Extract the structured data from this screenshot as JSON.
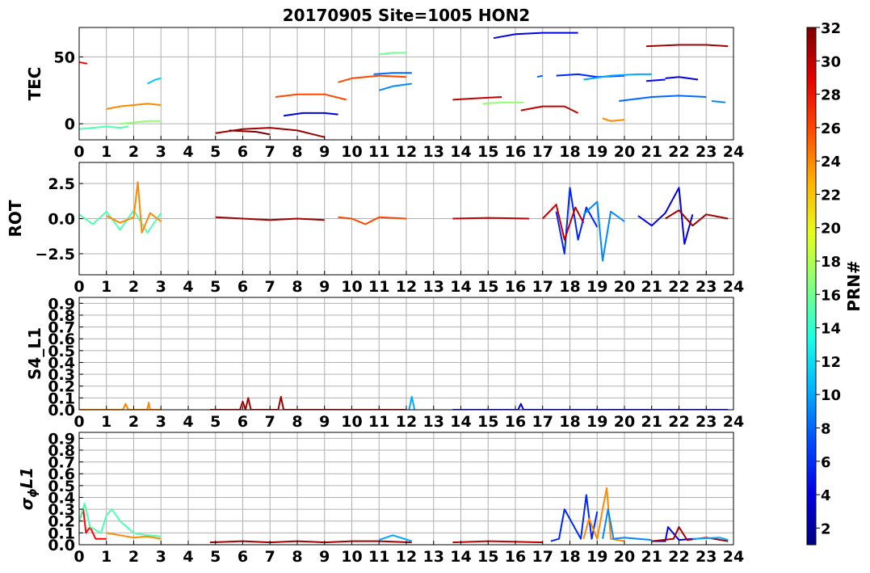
{
  "title": "20170905 Site=1005 HON2",
  "colorbar": {
    "label": "PRN#",
    "min": 1,
    "max": 32,
    "ticks": [
      2,
      4,
      6,
      8,
      10,
      12,
      14,
      16,
      18,
      20,
      22,
      24,
      26,
      28,
      30,
      32
    ],
    "colormap": "jet"
  },
  "chart_data": [
    {
      "type": "line",
      "ylabel": "TEC",
      "xlim": [
        0,
        24
      ],
      "ylim": [
        -12,
        72
      ],
      "xticks": [
        0,
        1,
        2,
        3,
        4,
        5,
        6,
        7,
        8,
        9,
        10,
        11,
        12,
        13,
        14,
        15,
        16,
        17,
        18,
        19,
        20,
        21,
        22,
        23,
        24
      ],
      "yticks": [
        0,
        50
      ],
      "grid": true,
      "series": [
        {
          "prn": 28,
          "x": [
            0.0,
            0.3
          ],
          "y": [
            46,
            45
          ]
        },
        {
          "prn": 15,
          "x": [
            0.0,
            0.5,
            1.0,
            1.5,
            1.8
          ],
          "y": [
            -4,
            -3,
            -2,
            -3,
            -2
          ]
        },
        {
          "prn": 17,
          "x": [
            1.5,
            2.0,
            2.5,
            3.0
          ],
          "y": [
            0,
            1,
            2,
            2
          ]
        },
        {
          "prn": 24,
          "x": [
            1.0,
            1.5,
            2.0,
            2.5,
            3.0
          ],
          "y": [
            11,
            13,
            14,
            15,
            14
          ]
        },
        {
          "prn": 11,
          "x": [
            2.5,
            2.8,
            3.0
          ],
          "y": [
            30,
            33,
            34
          ]
        },
        {
          "prn": 31,
          "x": [
            5.0,
            6.0,
            7.0,
            8.0,
            9.0
          ],
          "y": [
            -7,
            -4,
            -3,
            -5,
            -10
          ]
        },
        {
          "prn": 32,
          "x": [
            5.5,
            6.5,
            7.0
          ],
          "y": [
            -5,
            -6,
            -8
          ]
        },
        {
          "prn": 26,
          "x": [
            7.2,
            8.0,
            9.0,
            9.8
          ],
          "y": [
            20,
            22,
            22,
            18
          ]
        },
        {
          "prn": 4,
          "x": [
            7.5,
            8.2,
            9.0,
            9.5
          ],
          "y": [
            6,
            8,
            8,
            7
          ]
        },
        {
          "prn": 26,
          "x": [
            9.5,
            10.0,
            11.0,
            12.0
          ],
          "y": [
            31,
            34,
            36,
            35
          ]
        },
        {
          "prn": 16,
          "x": [
            11.0,
            11.5,
            12.0
          ],
          "y": [
            52,
            53,
            53
          ]
        },
        {
          "prn": 8,
          "x": [
            10.8,
            11.5,
            12.2
          ],
          "y": [
            37,
            38,
            38
          ]
        },
        {
          "prn": 9,
          "x": [
            11.0,
            11.5,
            12.2
          ],
          "y": [
            25,
            28,
            30
          ]
        },
        {
          "prn": 30,
          "x": [
            13.7,
            14.5,
            15.5
          ],
          "y": [
            18,
            19,
            20
          ]
        },
        {
          "prn": 17,
          "x": [
            14.8,
            15.5,
            16.3
          ],
          "y": [
            15,
            16,
            16
          ]
        },
        {
          "prn": 4,
          "x": [
            15.2,
            16.0,
            17.0,
            18.3
          ],
          "y": [
            64,
            67,
            68,
            68
          ]
        },
        {
          "prn": 30,
          "x": [
            16.2,
            17.0,
            17.8,
            18.3
          ],
          "y": [
            10,
            13,
            13,
            8
          ]
        },
        {
          "prn": 8,
          "x": [
            16.8,
            17.0
          ],
          "y": [
            35,
            36
          ]
        },
        {
          "prn": 6,
          "x": [
            17.5,
            18.3,
            19.0,
            20.0
          ],
          "y": [
            36,
            37,
            35,
            36
          ]
        },
        {
          "prn": 10,
          "x": [
            18.5,
            19.5,
            20.5,
            21.0
          ],
          "y": [
            33,
            36,
            37,
            37
          ]
        },
        {
          "prn": 24,
          "x": [
            19.2,
            19.5,
            20.0
          ],
          "y": [
            4,
            2,
            3
          ]
        },
        {
          "prn": 5,
          "x": [
            20.8,
            21.5
          ],
          "y": [
            32,
            33
          ]
        },
        {
          "prn": 4,
          "x": [
            21.5,
            22.0,
            22.7
          ],
          "y": [
            34,
            35,
            33
          ]
        },
        {
          "prn": 8,
          "x": [
            19.8,
            21.0,
            22.0,
            23.0
          ],
          "y": [
            17,
            20,
            21,
            20
          ]
        },
        {
          "prn": 9,
          "x": [
            23.2,
            23.7
          ],
          "y": [
            17,
            16
          ]
        },
        {
          "prn": 31,
          "x": [
            20.8,
            22.0,
            23.0,
            23.8
          ],
          "y": [
            58,
            59,
            59,
            58
          ]
        }
      ]
    },
    {
      "type": "line",
      "ylabel": "ROT",
      "xlim": [
        0,
        24
      ],
      "ylim": [
        -4,
        4
      ],
      "xticks": [
        0,
        1,
        2,
        3,
        4,
        5,
        6,
        7,
        8,
        9,
        10,
        11,
        12,
        13,
        14,
        15,
        16,
        17,
        18,
        19,
        20,
        21,
        22,
        23,
        24
      ],
      "yticks": [
        -2.5,
        0.0,
        2.5
      ],
      "grid": true,
      "series": [
        {
          "prn": 15,
          "x": [
            0.0,
            0.5,
            1.0,
            1.5,
            2.0,
            2.5,
            3.0
          ],
          "y": [
            0.3,
            -0.4,
            0.5,
            -0.8,
            0.6,
            -1.0,
            0.4
          ]
        },
        {
          "prn": 24,
          "x": [
            1.0,
            1.5,
            2.0,
            2.15,
            2.3,
            2.6,
            3.0
          ],
          "y": [
            0.2,
            -0.3,
            0.1,
            2.6,
            -1.0,
            0.4,
            -0.2
          ]
        },
        {
          "prn": 31,
          "x": [
            5.0,
            6.0,
            7.0,
            8.0,
            9.0
          ],
          "y": [
            0.1,
            0.0,
            -0.1,
            0.0,
            -0.1
          ]
        },
        {
          "prn": 26,
          "x": [
            9.5,
            10.0,
            10.5,
            11.0,
            12.0
          ],
          "y": [
            0.1,
            0.0,
            -0.4,
            0.1,
            0.0
          ]
        },
        {
          "prn": 30,
          "x": [
            13.7,
            15.0,
            16.5
          ],
          "y": [
            0.0,
            0.05,
            0.0
          ]
        },
        {
          "prn": 6,
          "x": [
            17.5,
            17.8,
            18.0,
            18.3,
            18.6,
            19.0
          ],
          "y": [
            0.5,
            -2.5,
            2.2,
            -1.5,
            0.8,
            -0.6
          ]
        },
        {
          "prn": 9,
          "x": [
            18.5,
            19.0,
            19.2,
            19.5,
            20.0
          ],
          "y": [
            0.3,
            1.2,
            -3.0,
            0.5,
            -0.2
          ]
        },
        {
          "prn": 30,
          "x": [
            17.0,
            17.5,
            17.8,
            18.2,
            18.5
          ],
          "y": [
            0.0,
            1.0,
            -1.5,
            0.8,
            -0.3
          ]
        },
        {
          "prn": 4,
          "x": [
            20.5,
            21.0,
            21.5,
            22.0,
            22.2,
            22.5
          ],
          "y": [
            0.2,
            -0.5,
            0.4,
            2.2,
            -1.8,
            0.3
          ]
        },
        {
          "prn": 31,
          "x": [
            21.5,
            22.0,
            22.5,
            23.0,
            23.8
          ],
          "y": [
            0.0,
            0.6,
            -0.5,
            0.3,
            0.0
          ]
        }
      ]
    },
    {
      "type": "line",
      "ylabel": "S4_L1",
      "xlim": [
        0,
        24
      ],
      "ylim": [
        0,
        0.95
      ],
      "xticks": [
        0,
        1,
        2,
        3,
        4,
        5,
        6,
        7,
        8,
        9,
        10,
        11,
        12,
        13,
        14,
        15,
        16,
        17,
        18,
        19,
        20,
        21,
        22,
        23,
        24
      ],
      "yticks": [
        0.0,
        0.1,
        0.2,
        0.3,
        0.4,
        0.5,
        0.6,
        0.7,
        0.8,
        0.9
      ],
      "grid": true,
      "series": [
        {
          "prn": 24,
          "x": [
            0.0,
            1.6,
            1.7,
            1.8,
            2.5,
            2.55,
            2.6,
            3.0
          ],
          "y": [
            0.0,
            0.0,
            0.05,
            0.0,
            0.0,
            0.06,
            0.0,
            0.0
          ]
        },
        {
          "prn": 31,
          "x": [
            4.8,
            5.9,
            6.0,
            6.1,
            6.2,
            6.3,
            7.3,
            7.4,
            7.5,
            12.0
          ],
          "y": [
            0.0,
            0.0,
            0.07,
            0.0,
            0.1,
            0.0,
            0.0,
            0.11,
            0.0,
            0.0
          ]
        },
        {
          "prn": 10,
          "x": [
            12.1,
            12.2,
            12.3
          ],
          "y": [
            0.0,
            0.11,
            0.0
          ]
        },
        {
          "prn": 4,
          "x": [
            13.7,
            16.1,
            16.2,
            16.3,
            23.8
          ],
          "y": [
            0.0,
            0.0,
            0.05,
            0.0,
            0.0
          ]
        }
      ]
    },
    {
      "type": "line",
      "ylabel": "σϕL1",
      "xlim": [
        0,
        24
      ],
      "ylim": [
        0,
        0.95
      ],
      "xticks": [
        0,
        1,
        2,
        3,
        4,
        5,
        6,
        7,
        8,
        9,
        10,
        11,
        12,
        13,
        14,
        15,
        16,
        17,
        18,
        19,
        20,
        21,
        22,
        23,
        24
      ],
      "yticks": [
        0.0,
        0.1,
        0.2,
        0.3,
        0.4,
        0.5,
        0.6,
        0.7,
        0.8,
        0.9
      ],
      "grid": true,
      "series": [
        {
          "prn": 28,
          "x": [
            0.0,
            0.15,
            0.25,
            0.4,
            0.6,
            1.0
          ],
          "y": [
            0.2,
            0.3,
            0.1,
            0.15,
            0.05,
            0.05
          ]
        },
        {
          "prn": 15,
          "x": [
            0.0,
            0.2,
            0.4,
            0.8,
            1.0,
            1.2,
            1.5,
            2.0,
            2.5,
            3.0
          ],
          "y": [
            0.2,
            0.35,
            0.15,
            0.1,
            0.25,
            0.3,
            0.2,
            0.1,
            0.08,
            0.07
          ]
        },
        {
          "prn": 24,
          "x": [
            1.0,
            1.5,
            2.0,
            2.5,
            3.0
          ],
          "y": [
            0.1,
            0.08,
            0.06,
            0.07,
            0.05
          ]
        },
        {
          "prn": 31,
          "x": [
            4.8,
            6.0,
            7.0,
            8.0,
            9.0,
            10.0,
            11.0,
            12.2
          ],
          "y": [
            0.02,
            0.03,
            0.02,
            0.03,
            0.02,
            0.03,
            0.03,
            0.02
          ]
        },
        {
          "prn": 10,
          "x": [
            11.0,
            11.5,
            12.2
          ],
          "y": [
            0.04,
            0.08,
            0.03
          ]
        },
        {
          "prn": 30,
          "x": [
            13.7,
            15.0,
            17.0
          ],
          "y": [
            0.02,
            0.03,
            0.02
          ]
        },
        {
          "prn": 6,
          "x": [
            17.3,
            17.6,
            17.8,
            18.4,
            18.6,
            18.8,
            19.0
          ],
          "y": [
            0.03,
            0.05,
            0.3,
            0.05,
            0.42,
            0.05,
            0.28
          ]
        },
        {
          "prn": 24,
          "x": [
            18.5,
            18.7,
            19.0,
            19.2,
            19.35,
            19.5,
            20.0
          ],
          "y": [
            0.05,
            0.22,
            0.05,
            0.3,
            0.48,
            0.05,
            0.03
          ]
        },
        {
          "prn": 9,
          "x": [
            19.2,
            19.4,
            19.6,
            20.0,
            21.0
          ],
          "y": [
            0.05,
            0.3,
            0.05,
            0.06,
            0.04
          ]
        },
        {
          "prn": 4,
          "x": [
            21.0,
            21.5,
            21.6,
            22.0,
            22.5
          ],
          "y": [
            0.03,
            0.03,
            0.15,
            0.04,
            0.05
          ]
        },
        {
          "prn": 31,
          "x": [
            21.0,
            21.8,
            22.0,
            22.3,
            23.0,
            23.8
          ],
          "y": [
            0.03,
            0.05,
            0.15,
            0.04,
            0.06,
            0.03
          ]
        },
        {
          "prn": 10,
          "x": [
            22.5,
            23.5,
            23.8
          ],
          "y": [
            0.05,
            0.06,
            0.04
          ]
        }
      ]
    }
  ]
}
